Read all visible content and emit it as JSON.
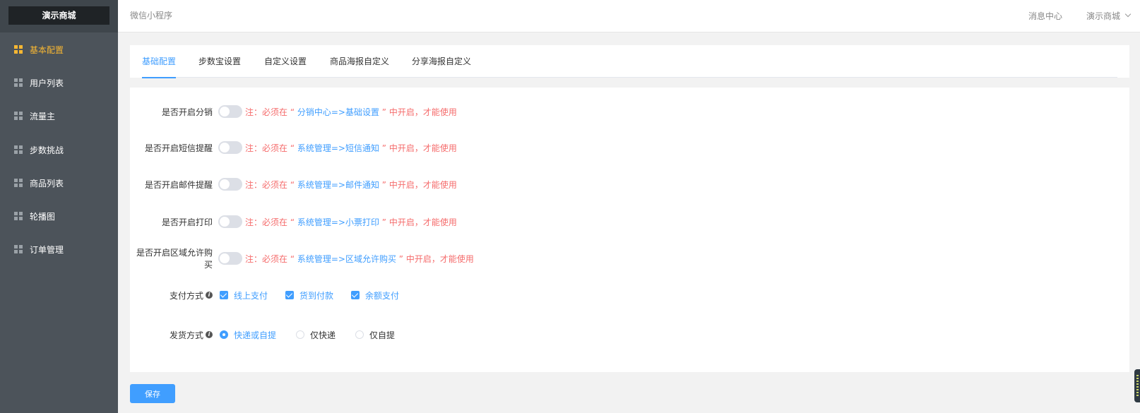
{
  "app": {
    "logo": "演示商城"
  },
  "sidebar": {
    "items": [
      {
        "label": "基本配置",
        "active": true
      },
      {
        "label": "用户列表"
      },
      {
        "label": "流量主"
      },
      {
        "label": "步数挑战"
      },
      {
        "label": "商品列表"
      },
      {
        "label": "轮播图"
      },
      {
        "label": "订单管理"
      }
    ]
  },
  "header": {
    "breadcrumb": "微信小程序",
    "message_center": "消息中心",
    "user_menu": "演示商城"
  },
  "tabs": [
    {
      "label": "基础配置",
      "active": true
    },
    {
      "label": "步数宝设置"
    },
    {
      "label": "自定义设置"
    },
    {
      "label": "商品海报自定义"
    },
    {
      "label": "分享海报自定义"
    }
  ],
  "form": {
    "toggles": [
      {
        "label": "是否开启分销",
        "note_prefix": "注：必须在 “ ",
        "note_link": "分销中心=>基础设置",
        "note_suffix": " ” 中开启，才能使用",
        "enabled": false
      },
      {
        "label": "是否开启短信提醒",
        "note_prefix": "注：必须在 “ ",
        "note_link": "系统管理=>短信通知",
        "note_suffix": " ” 中开启，才能使用",
        "enabled": false
      },
      {
        "label": "是否开启邮件提醒",
        "note_prefix": "注：必须在 “ ",
        "note_link": "系统管理=>邮件通知",
        "note_suffix": " ” 中开启，才能使用",
        "enabled": false
      },
      {
        "label": "是否开启打印",
        "note_prefix": "注：必须在 “ ",
        "note_link": "系统管理=>小票打印",
        "note_suffix": " ” 中开启，才能使用",
        "enabled": false
      },
      {
        "label": "是否开启区域允许购买",
        "note_prefix": "注：必须在 “ ",
        "note_link": "系统管理=>区域允许购买",
        "note_suffix": " ” 中开启，才能使用",
        "enabled": false
      }
    ],
    "payment": {
      "label": "支付方式",
      "info_icon": "i",
      "options": [
        {
          "label": "线上支付",
          "checked": true
        },
        {
          "label": "货到付款",
          "checked": true
        },
        {
          "label": "余额支付",
          "checked": true
        }
      ]
    },
    "delivery": {
      "label": "发货方式",
      "info_icon": "i",
      "options": [
        {
          "label": "快递或自提",
          "selected": true
        },
        {
          "label": "仅快递",
          "selected": false
        },
        {
          "label": "仅自提",
          "selected": false
        }
      ]
    }
  },
  "actions": {
    "save_label": "保存"
  },
  "colors": {
    "primary": "#409eff",
    "warning_text": "#f56c6c",
    "sidebar_bg": "#4c535a",
    "active_menu": "#f7b733"
  },
  "icons": {
    "menu": "grid-icon",
    "user_chevron": "chevron-down-icon",
    "info": "info-icon"
  }
}
